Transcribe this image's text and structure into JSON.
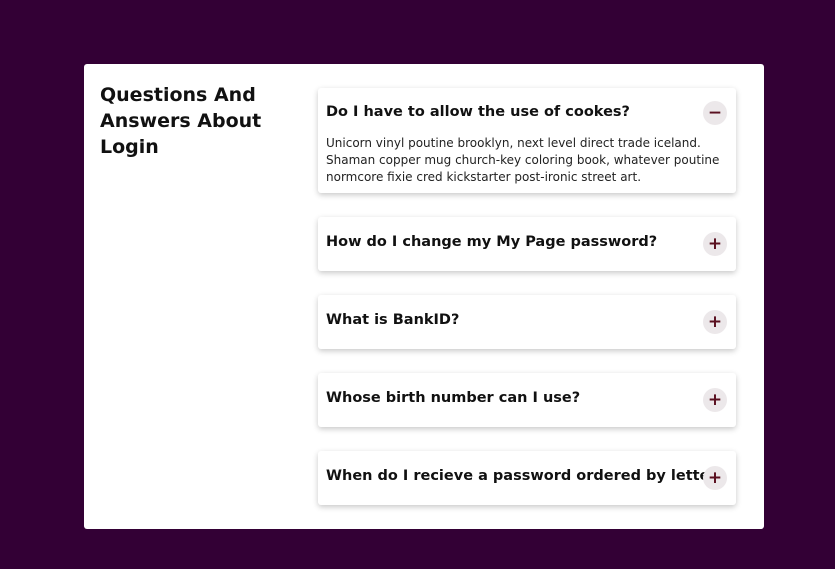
{
  "page": {
    "title": "Questions And Answers About Login"
  },
  "faq": [
    {
      "question": "Do I have to allow the use of cookes?",
      "answer": "Unicorn vinyl poutine brooklyn, next level direct trade iceland. Shaman copper mug church-key coloring book, whatever poutine normcore fixie cred kickstarter post-ironic street art.",
      "expanded": true,
      "toggle_icon": "−"
    },
    {
      "question": "How do I change my My Page password?",
      "expanded": false,
      "toggle_icon": "+"
    },
    {
      "question": "What is BankID?",
      "expanded": false,
      "toggle_icon": "+"
    },
    {
      "question": "Whose birth number can I use?",
      "expanded": false,
      "toggle_icon": "+"
    },
    {
      "question": "When do I recieve a password ordered by letter?",
      "expanded": false,
      "toggle_icon": "+"
    }
  ],
  "colors": {
    "background": "#330035",
    "card": "#ffffff",
    "toggle_bg": "#ece8ea",
    "toggle_fg": "#5a1020"
  }
}
